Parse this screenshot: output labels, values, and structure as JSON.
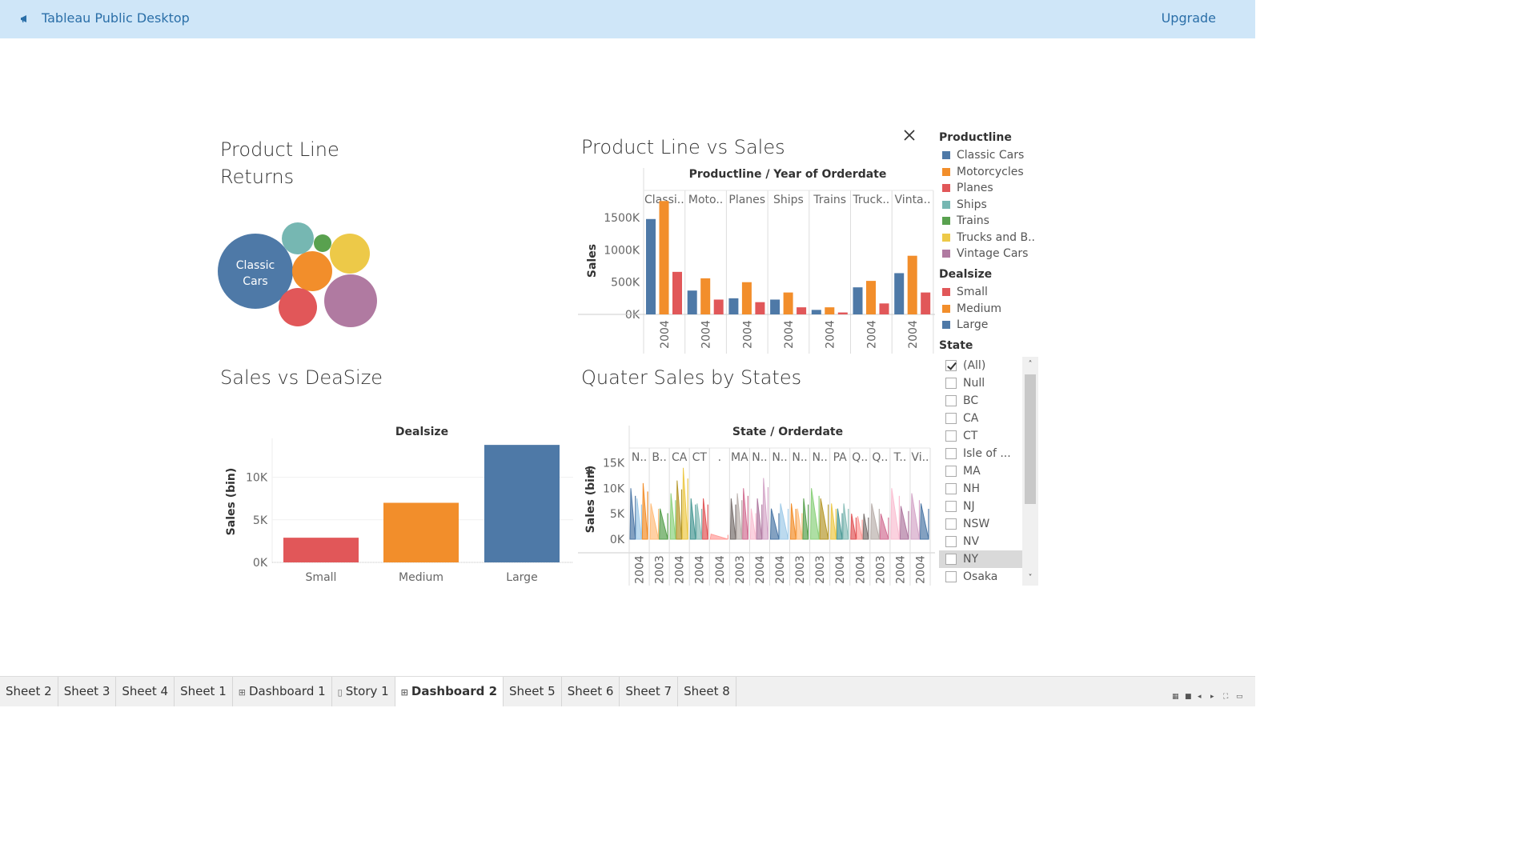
{
  "app": {
    "title": "Tableau Public Desktop",
    "upgrade_label": "Upgrade"
  },
  "colors": {
    "classic_cars": "#4e79a7",
    "motorcycles": "#f28e2b",
    "planes": "#e15759",
    "ships": "#76b7b2",
    "trains": "#59a14f",
    "trucks": "#edc948",
    "vintage": "#b07aa1",
    "small": "#e15759",
    "medium": "#f28e2b",
    "large": "#4e79a7",
    "topbar": "#cfe6f8"
  },
  "sheets": {
    "product_line_returns": {
      "title_line1": "Product Line",
      "title_line2": "Returns",
      "bubble_label": "Classic Cars"
    },
    "product_line_vs_sales": {
      "title": "Product Line vs Sales"
    },
    "sales_vs_deasize": {
      "title": "Sales vs DeaSize"
    },
    "quater_sales": {
      "title": "Quater Sales by States"
    }
  },
  "chart_data": [
    {
      "type": "bubble",
      "title": "Product Line Returns",
      "categories": [
        "Classic Cars",
        "Motorcycles",
        "Planes",
        "Ships",
        "Trains",
        "Trucks and Buses",
        "Vintage Cars"
      ],
      "relative_values": [
        47,
        25,
        24,
        20,
        11,
        25,
        33
      ],
      "labels": [
        "Classic Cars"
      ]
    },
    {
      "type": "bar",
      "title": "Product Line vs Sales",
      "header": "Productline / Year of Orderdate",
      "column_labels": [
        "Classi..",
        "Moto..",
        "Planes",
        "Ships",
        "Trains",
        "Truck..",
        "Vinta.."
      ],
      "year_labels": [
        "2004",
        "2004",
        "2004",
        "2004",
        "2004",
        "2004",
        "2004"
      ],
      "ylabel": "Sales",
      "yticks": [
        "0K",
        "500K",
        "1000K",
        "1500K"
      ],
      "ylim": [
        0,
        1800000
      ],
      "series": [
        {
          "name": "Large",
          "values": [
            1480000,
            370000,
            250000,
            230000,
            70000,
            420000,
            640000
          ]
        },
        {
          "name": "Medium",
          "values": [
            1760000,
            560000,
            500000,
            340000,
            110000,
            520000,
            910000
          ]
        },
        {
          "name": "Small",
          "values": [
            660000,
            230000,
            190000,
            110000,
            30000,
            170000,
            340000
          ]
        }
      ]
    },
    {
      "type": "bar",
      "title": "Sales vs DeaSize",
      "header": "Dealsize",
      "categories": [
        "Small",
        "Medium",
        "Large"
      ],
      "values": [
        2900,
        7000,
        13800
      ],
      "ylabel": "Sales (bin)",
      "yticks": [
        "0K",
        "5K",
        "10K"
      ],
      "ylim": [
        0,
        14000
      ]
    },
    {
      "type": "area",
      "title": "Quater Sales by States",
      "header": "State / Orderdate",
      "ylabel": "Sales (bin)",
      "yticks": [
        "0K",
        "5K",
        "10K",
        "15K"
      ],
      "ylim": [
        0,
        16000
      ],
      "state_labels": [
        "N..",
        "B..",
        "CA",
        "CT",
        ".",
        "MA",
        "N..",
        "N..",
        "N..",
        "N..",
        "PA",
        "Q..",
        "Q..",
        "T..",
        "Vi.."
      ],
      "year_labels": [
        "2004",
        "2003",
        "2004",
        "2004",
        "2004",
        "2003",
        "2004",
        "2004",
        "2003",
        "2003",
        "2004",
        "2004",
        "2003",
        "2004",
        "2004"
      ],
      "peaks": [
        [
          10000,
          8000,
          11000
        ],
        [
          7000,
          6000
        ],
        [
          9000,
          11500,
          14000
        ],
        [
          8000,
          7000,
          8000
        ],
        [
          1000
        ],
        [
          8000,
          9000,
          10000
        ],
        [
          6000,
          8000,
          12000
        ],
        [
          6000,
          7000
        ],
        [
          7000,
          6000,
          8000
        ],
        [
          10000,
          8000
        ],
        [
          7000,
          6000,
          7000
        ],
        [
          5000,
          4500,
          5000
        ],
        [
          7000,
          5000
        ],
        [
          10000,
          6500
        ],
        [
          9000,
          7000
        ]
      ]
    }
  ],
  "legend_productline": {
    "title": "Productline",
    "items": [
      {
        "label": "Classic Cars",
        "color": "#4e79a7"
      },
      {
        "label": "Motorcycles",
        "color": "#f28e2b"
      },
      {
        "label": "Planes",
        "color": "#e15759"
      },
      {
        "label": "Ships",
        "color": "#76b7b2"
      },
      {
        "label": "Trains",
        "color": "#59a14f"
      },
      {
        "label": "Trucks and B..",
        "color": "#edc948"
      },
      {
        "label": "Vintage Cars",
        "color": "#b07aa1"
      }
    ]
  },
  "legend_dealsize": {
    "title": "Dealsize",
    "items": [
      {
        "label": "Small",
        "color": "#e15759"
      },
      {
        "label": "Medium",
        "color": "#f28e2b"
      },
      {
        "label": "Large",
        "color": "#4e79a7"
      }
    ]
  },
  "state_filter": {
    "title": "State",
    "items": [
      {
        "label": "(All)",
        "checked": true
      },
      {
        "label": "Null",
        "checked": false
      },
      {
        "label": "BC",
        "checked": false
      },
      {
        "label": "CA",
        "checked": false
      },
      {
        "label": "CT",
        "checked": false
      },
      {
        "label": "Isle of ...",
        "checked": false
      },
      {
        "label": "MA",
        "checked": false
      },
      {
        "label": "NH",
        "checked": false
      },
      {
        "label": "NJ",
        "checked": false
      },
      {
        "label": "NSW",
        "checked": false
      },
      {
        "label": "NV",
        "checked": false
      },
      {
        "label": "NY",
        "checked": false,
        "highlighted": true
      },
      {
        "label": "Osaka",
        "checked": false
      }
    ]
  },
  "tabs": [
    {
      "label": "Sheet 2",
      "icon": ""
    },
    {
      "label": "Sheet 3",
      "icon": ""
    },
    {
      "label": "Sheet 4",
      "icon": ""
    },
    {
      "label": "Sheet 1",
      "icon": ""
    },
    {
      "label": "Dashboard 1",
      "icon": "⊞"
    },
    {
      "label": "Story 1",
      "icon": "▯"
    },
    {
      "label": "Dashboard 2",
      "icon": "⊞",
      "active": true
    },
    {
      "label": "Sheet 5",
      "icon": ""
    },
    {
      "label": "Sheet 6",
      "icon": ""
    },
    {
      "label": "Sheet 7",
      "icon": ""
    },
    {
      "label": "Sheet 8",
      "icon": ""
    }
  ],
  "status_icons": [
    "grid-view-icon",
    "filmstrip-icon",
    "prev-sheet-icon",
    "next-sheet-icon",
    "fit-icon",
    "presentation-icon"
  ]
}
